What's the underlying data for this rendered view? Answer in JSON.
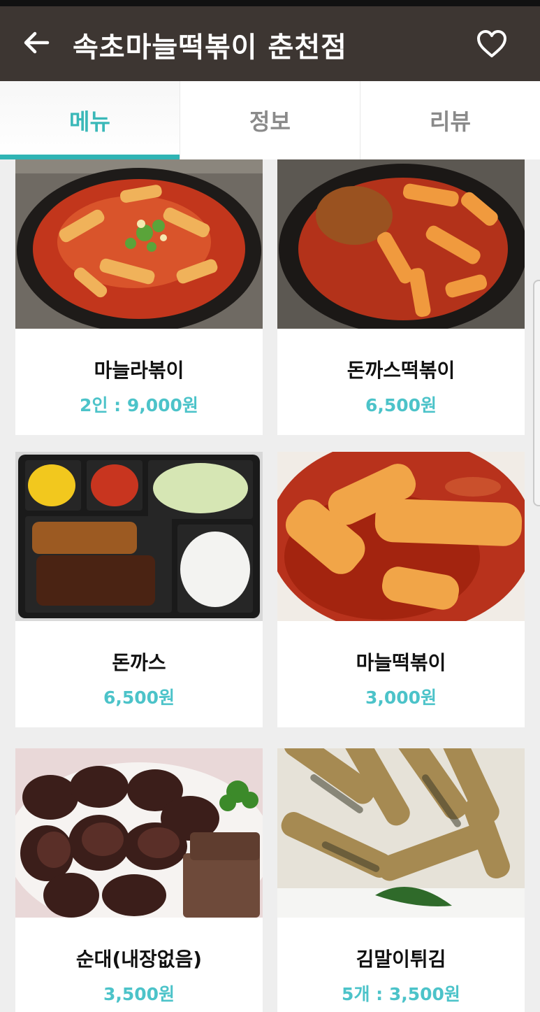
{
  "header": {
    "title": "속초마늘떡볶이 춘천점",
    "back_icon": "arrow-left-icon",
    "favorite_icon": "heart-outline-icon"
  },
  "tabs": [
    {
      "label": "메뉴",
      "active": true
    },
    {
      "label": "정보",
      "active": false
    },
    {
      "label": "리뷰",
      "active": false
    }
  ],
  "menu": [
    {
      "name": "마늘라볶이",
      "price": "2인 : 9,000원"
    },
    {
      "name": "돈까스떡볶이",
      "price": "6,500원"
    },
    {
      "name": "돈까스",
      "price": "6,500원"
    },
    {
      "name": "마늘떡볶이",
      "price": "3,000원"
    },
    {
      "name": "순대(내장없음)",
      "price": "3,500원"
    },
    {
      "name": "김말이튀김",
      "price": "5개 : 3,500원"
    }
  ],
  "colors": {
    "appbar": "#3d3632",
    "accent": "#2fb4b4",
    "price": "#4cc3c9"
  }
}
